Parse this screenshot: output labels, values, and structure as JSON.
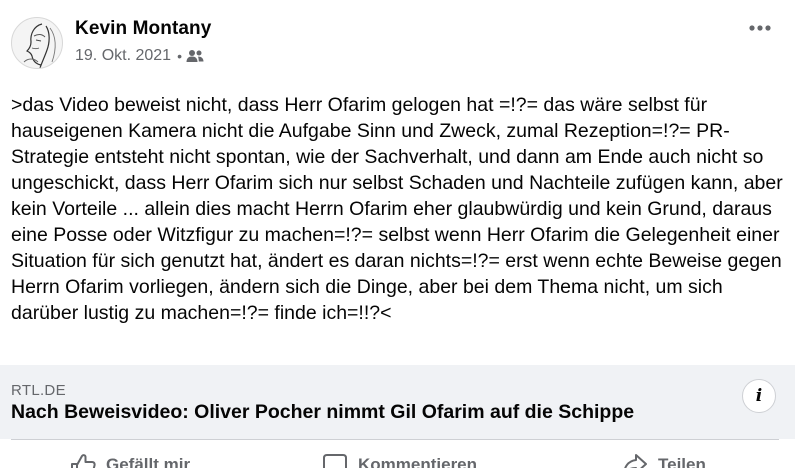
{
  "post": {
    "author": "Kevin Montany",
    "date": "19. Okt. 2021",
    "separator": "•",
    "audience_icon": "friends-icon",
    "more_icon": "more-horizontal-icon",
    "text": ">das Video beweist nicht, dass Herr Ofarim gelogen hat =!?= das wäre selbst für hauseigenen Kamera nicht die Aufgabe Sinn und Zweck, zumal Rezeption=!?= PR-Strategie entsteht nicht spontan, wie der Sachverhalt,  und dann am Ende auch nicht so ungeschickt, dass Herr Ofarim sich nur selbst Schaden  und Nachteile zufügen kann, aber kein Vorteile ... allein dies macht Herrn Ofarim eher glaubwürdig und kein Grund, daraus eine Posse oder Witzfigur zu machen=!?= selbst wenn Herr Ofarim die Gelegenheit einer  Situation für sich genutzt hat, ändert es daran nichts=!?= erst wenn echte Beweise gegen Herrn Ofarim vorliegen, ändern sich die Dinge, aber bei dem Thema nicht,  um sich darüber lustig zu machen=!?= finde ich=!!?<"
  },
  "link_preview": {
    "domain": "RTL.DE",
    "title": "Nach Beweisvideo: Oliver Pocher nimmt Gil Ofarim auf die Schippe",
    "info_label": "i"
  },
  "actions": {
    "like": "Gefällt mir",
    "comment": "Kommentieren",
    "share": "Teilen"
  },
  "colors": {
    "text": "#050505",
    "secondary": "#65676b",
    "card_background": "#f0f2f5"
  }
}
